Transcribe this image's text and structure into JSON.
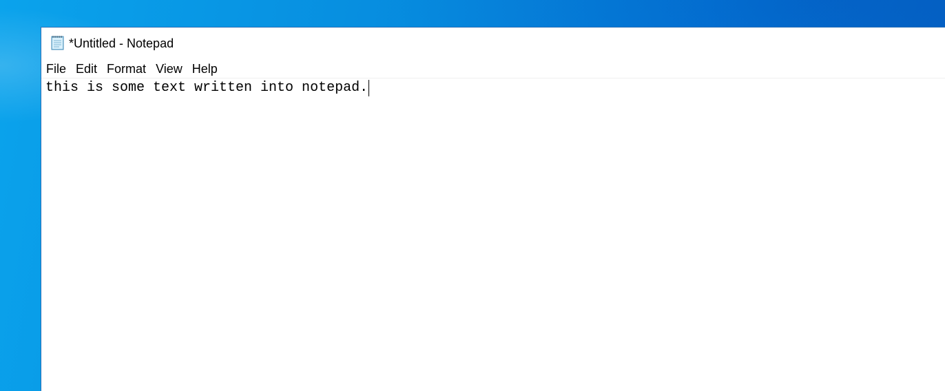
{
  "window": {
    "title": "*Untitled - Notepad",
    "app_icon": "notepad-icon"
  },
  "menu": {
    "items": [
      {
        "label": "File"
      },
      {
        "label": "Edit"
      },
      {
        "label": "Format"
      },
      {
        "label": "View"
      },
      {
        "label": "Help"
      }
    ]
  },
  "editor": {
    "content": "this is some text written into notepad."
  },
  "colors": {
    "desktop_accent": "#078fe0",
    "window_background": "#ffffff",
    "text": "#000000"
  }
}
